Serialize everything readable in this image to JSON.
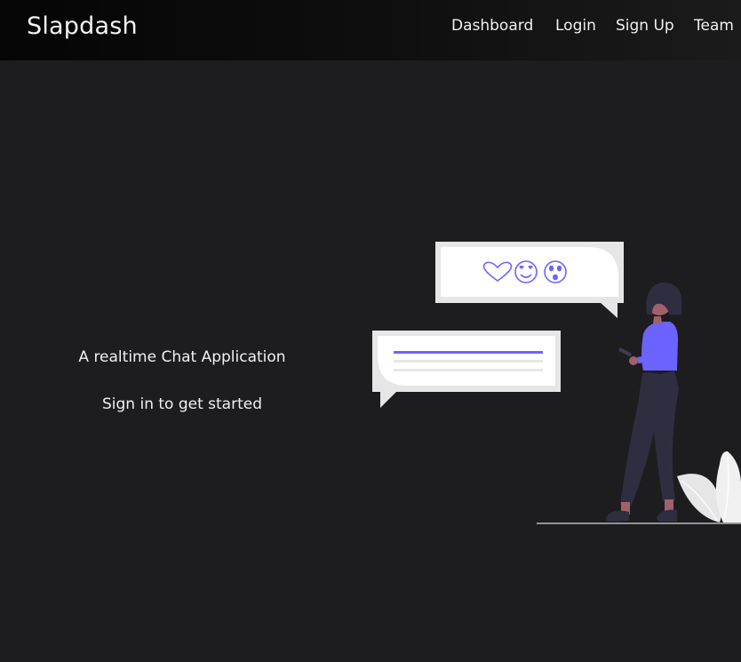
{
  "navbar": {
    "brand": "Slapdash",
    "links": [
      {
        "label": "Dashboard"
      },
      {
        "label": "Login"
      },
      {
        "label": "Sign Up"
      },
      {
        "label": "Team"
      }
    ]
  },
  "hero": {
    "tagline": "A realtime Chat Application",
    "cta": "Sign in to get started"
  },
  "colors": {
    "background": "#1d1d1f",
    "navbar": "#0a0a0a",
    "accent": "#6c63ff",
    "bubble": "#ffffff",
    "bubble_frame": "#e6e6e6",
    "text": "#ececec"
  },
  "illustration": {
    "name": "woman-texting-illustration",
    "emoji_icons": [
      "heart-icon",
      "heart-eyes-emoji-icon",
      "surprised-emoji-icon"
    ]
  }
}
